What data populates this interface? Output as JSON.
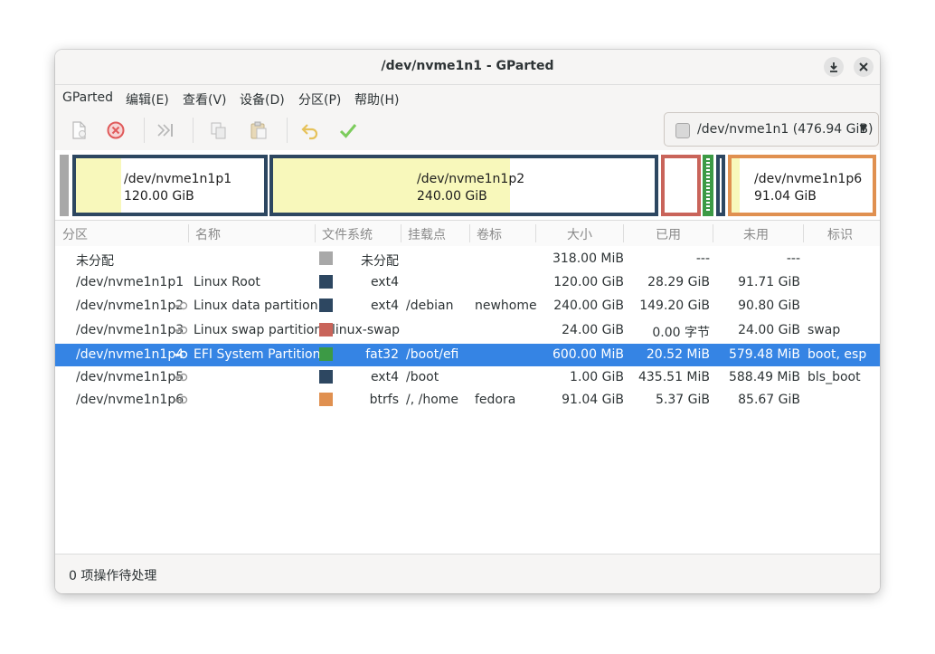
{
  "window": {
    "title": "/dev/nvme1n1 - GParted"
  },
  "menubar": [
    "GParted",
    "编辑(E)",
    "查看(V)",
    "设备(D)",
    "分区(P)",
    "帮助(H)"
  ],
  "toolbar": {
    "icons": [
      "new-partition-icon",
      "delete-icon",
      "resize-move-icon",
      "copy-icon",
      "paste-icon",
      "undo-icon",
      "apply-icon"
    ]
  },
  "device": {
    "label": "/dev/nvme1n1  (476.94 GiB)"
  },
  "disk_map": [
    {
      "name": "/dev/nvme1n1p1",
      "size": "120.00 GiB",
      "border": "#2d4761",
      "used_fraction": 0.24
    },
    {
      "name": "/dev/nvme1n1p2",
      "size": "240.00 GiB",
      "border": "#2d4761",
      "used_fraction": 0.62
    },
    {
      "name": "",
      "size": "",
      "border": "#c9645a",
      "used_fraction": 0.0
    },
    {
      "name": "",
      "size": "",
      "border": "#3c9a45",
      "used_fraction": 0.0
    },
    {
      "name": "",
      "size": "",
      "border": "#2d4761",
      "used_fraction": 0.0
    },
    {
      "name": "/dev/nvme1n1p6",
      "size": "91.04 GiB",
      "border": "#e09050",
      "used_fraction": 0.06
    }
  ],
  "columns": [
    "分区",
    "名称",
    "文件系统",
    "挂载点",
    "卷标",
    "大小",
    "已用",
    "未用",
    "标识"
  ],
  "rows": [
    {
      "partition": "未分配",
      "name": "",
      "fs": "未分配",
      "fs_color": "#a8a8a8",
      "mount": "",
      "label": "",
      "size": "318.00 MiB",
      "used": "---",
      "unused": "---",
      "flags": "",
      "key": false,
      "selected": false
    },
    {
      "partition": "/dev/nvme1n1p1",
      "name": "Linux Root",
      "fs": "ext4",
      "fs_color": "#2d4761",
      "mount": "",
      "label": "",
      "size": "120.00 GiB",
      "used": "28.29 GiB",
      "unused": "91.71 GiB",
      "flags": "",
      "key": false,
      "selected": false
    },
    {
      "partition": "/dev/nvme1n1p2",
      "name": "Linux data partition",
      "fs": "ext4",
      "fs_color": "#2d4761",
      "mount": "/debian",
      "label": "newhome",
      "size": "240.00 GiB",
      "used": "149.20 GiB",
      "unused": "90.80 GiB",
      "flags": "",
      "key": true,
      "selected": false
    },
    {
      "partition": "/dev/nvme1n1p3",
      "name": "Linux swap partition",
      "fs": "linux-swap",
      "fs_color": "#c9645a",
      "mount": "",
      "label": "",
      "size": "24.00 GiB",
      "used": "0.00 字节",
      "unused": "24.00 GiB",
      "flags": "swap",
      "key": true,
      "selected": false
    },
    {
      "partition": "/dev/nvme1n1p4",
      "name": "EFI System Partition",
      "fs": "fat32",
      "fs_color": "#3c9a45",
      "mount": "/boot/efi",
      "label": "",
      "size": "600.00 MiB",
      "used": "20.52 MiB",
      "unused": "579.48 MiB",
      "flags": "boot, esp",
      "key": true,
      "selected": true
    },
    {
      "partition": "/dev/nvme1n1p5",
      "name": "",
      "fs": "ext4",
      "fs_color": "#2d4761",
      "mount": "/boot",
      "label": "",
      "size": "1.00 GiB",
      "used": "435.51 MiB",
      "unused": "588.49 MiB",
      "flags": "bls_boot",
      "key": true,
      "selected": false
    },
    {
      "partition": "/dev/nvme1n1p6",
      "name": "",
      "fs": "btrfs",
      "fs_color": "#e09050",
      "mount": "/, /home",
      "label": "fedora",
      "size": "91.04 GiB",
      "used": "5.37 GiB",
      "unused": "85.67 GiB",
      "flags": "",
      "key": true,
      "selected": false
    }
  ],
  "statusbar": {
    "text": "0 项操作待处理"
  }
}
